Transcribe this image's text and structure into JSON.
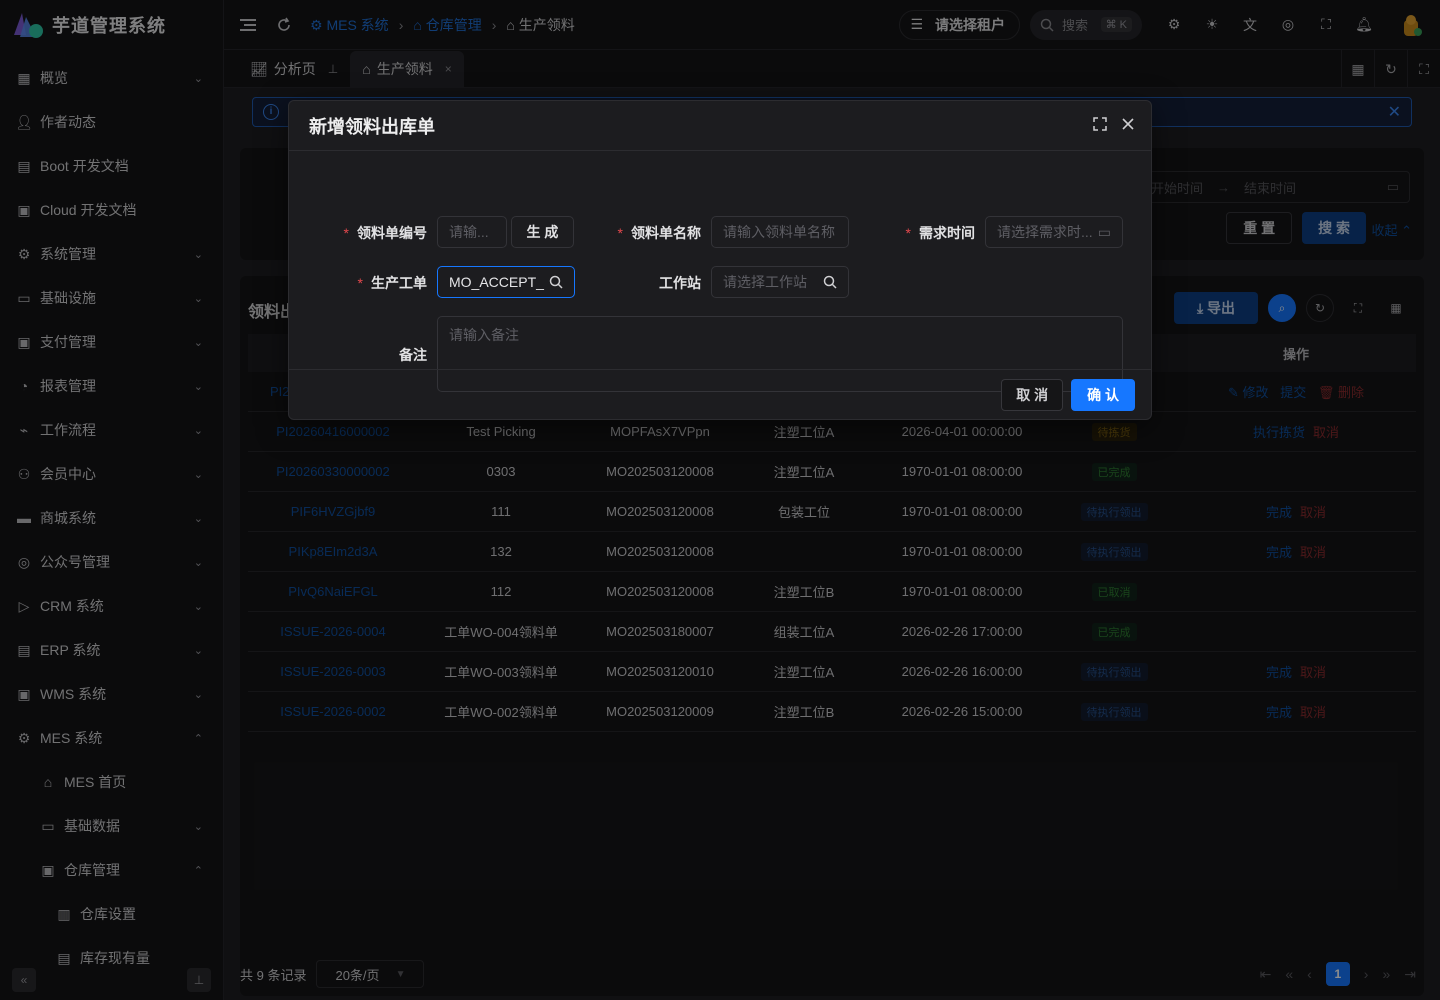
{
  "app": {
    "title": "芋道管理系统"
  },
  "sidebar": {
    "items": [
      {
        "label": "概览",
        "icon": "grid-icon",
        "arrow": "⌄"
      },
      {
        "label": "作者动态",
        "icon": "user-icon",
        "arrow": ""
      },
      {
        "label": "Boot 开发文档",
        "icon": "doc-icon",
        "arrow": ""
      },
      {
        "label": "Cloud 开发文档",
        "icon": "doc2-icon",
        "arrow": ""
      },
      {
        "label": "系统管理",
        "icon": "gear-icon",
        "arrow": "⌄"
      },
      {
        "label": "基础设施",
        "icon": "monitor-icon",
        "arrow": "⌄"
      },
      {
        "label": "支付管理",
        "icon": "pay-icon",
        "arrow": "⌄"
      },
      {
        "label": "报表管理",
        "icon": "pie-icon",
        "arrow": "⌄"
      },
      {
        "label": "工作流程",
        "icon": "flow-icon",
        "arrow": "⌄"
      },
      {
        "label": "会员中心",
        "icon": "members-icon",
        "arrow": "⌄"
      },
      {
        "label": "商城系统",
        "icon": "shop-icon",
        "arrow": "⌄"
      },
      {
        "label": "公众号管理",
        "icon": "compass-icon",
        "arrow": "⌄"
      },
      {
        "label": "CRM 系统",
        "icon": "crm-icon",
        "arrow": "⌄"
      },
      {
        "label": "ERP 系统",
        "icon": "erp-icon",
        "arrow": "⌄"
      },
      {
        "label": "WMS 系统",
        "icon": "box-icon",
        "arrow": "⌄"
      },
      {
        "label": "MES 系统",
        "icon": "chip-icon",
        "arrow": "⌃"
      }
    ],
    "mes_children": [
      {
        "label": "MES 首页",
        "icon": "home-icon",
        "arrow": ""
      },
      {
        "label": "基础数据",
        "icon": "screen-icon",
        "arrow": "⌄"
      },
      {
        "label": "仓库管理",
        "icon": "warehouse-icon",
        "arrow": "⌃"
      }
    ],
    "warehouse_children": [
      {
        "label": "仓库设置",
        "icon": "building-icon"
      },
      {
        "label": "库存现有量",
        "icon": "stock-icon"
      }
    ]
  },
  "header": {
    "breadcrumbs": [
      "MES 系统",
      "仓库管理",
      "生产领料"
    ],
    "tenant": "请选择租户",
    "search_placeholder": "搜索",
    "search_shortcut": "⌘ K"
  },
  "tabs": [
    {
      "label": "分析页",
      "icon": "chart-icon"
    },
    {
      "label": "生产领料",
      "icon": "issue-icon",
      "close": "×"
    }
  ],
  "filter": {
    "start_placeholder": "开始时间",
    "end_placeholder": "结束时间",
    "reset_label": "重 置",
    "search_label": "搜 索",
    "collapse_label": "收起"
  },
  "table": {
    "title": "领料出库单",
    "export_label": "导出",
    "op_header": "操作",
    "rows": [
      {
        "code": "PI20260416000002",
        "name": "Test Picking",
        "order": "MOPFAsX7VPpn",
        "station": "注塑工位A",
        "time": "2026-04-01 00:00:00",
        "status": "待拣货",
        "status_type": "warn",
        "actions": [
          {
            "t": "执行拣货",
            "c": "blue"
          },
          {
            "t": "取消",
            "c": "red"
          }
        ]
      },
      {
        "code": "PI20260330000002",
        "name": "0303",
        "order": "MO202503120008",
        "station": "注塑工位A",
        "time": "1970-01-01 08:00:00",
        "status": "已完成",
        "status_type": "ok",
        "actions": []
      },
      {
        "code": "PIF6HVZGjbf9",
        "name": "111",
        "order": "MO202503120008",
        "station": "包装工位",
        "time": "1970-01-01 08:00:00",
        "status": "待执行领出",
        "status_type": "blue",
        "actions": [
          {
            "t": "完成",
            "c": "blue"
          },
          {
            "t": "取消",
            "c": "red"
          }
        ]
      },
      {
        "code": "PIKp8EIm2d3A",
        "name": "132",
        "order": "MO202503120008",
        "station": "",
        "time": "1970-01-01 08:00:00",
        "status": "待执行领出",
        "status_type": "blue",
        "actions": [
          {
            "t": "完成",
            "c": "blue"
          },
          {
            "t": "取消",
            "c": "red"
          }
        ]
      },
      {
        "code": "PIvQ6NaiEFGL",
        "name": "112",
        "order": "MO202503120008",
        "station": "注塑工位B",
        "time": "1970-01-01 08:00:00",
        "status": "已取消",
        "status_type": "ok",
        "actions": []
      },
      {
        "code": "ISSUE-2026-0004",
        "name": "工单WO-004领料单",
        "order": "MO202503180007",
        "station": "组装工位A",
        "time": "2026-02-26 17:00:00",
        "status": "已完成",
        "status_type": "ok",
        "actions": []
      },
      {
        "code": "ISSUE-2026-0003",
        "name": "工单WO-003领料单",
        "order": "MO202503120010",
        "station": "注塑工位A",
        "time": "2026-02-26 16:00:00",
        "status": "待执行领出",
        "status_type": "blue",
        "actions": [
          {
            "t": "完成",
            "c": "blue"
          },
          {
            "t": "取消",
            "c": "red"
          }
        ]
      },
      {
        "code": "ISSUE-2026-0002",
        "name": "工单WO-002领料单",
        "order": "MO202503120009",
        "station": "注塑工位B",
        "time": "2026-02-26 15:00:00",
        "status": "待执行领出",
        "status_type": "blue",
        "actions": [
          {
            "t": "完成",
            "c": "blue"
          },
          {
            "t": "取消",
            "c": "red"
          }
        ]
      }
    ],
    "first_row_actions": [
      "修改",
      "提交",
      "删除"
    ],
    "first_row_code_fragment": "PI2"
  },
  "pager": {
    "total": "共 9 条记录",
    "page_size": "20条/页",
    "current_page": "1"
  },
  "modal": {
    "title": "新增领料出库单",
    "code_label": "领料单编号",
    "code_placeholder": "请输...",
    "generate_label": "生 成",
    "name_label": "领料单名称",
    "name_placeholder": "请输入领料单名称",
    "time_label": "需求时间",
    "time_placeholder": "请选择需求时...",
    "order_label": "生产工单",
    "order_value": "MO_ACCEPT_I",
    "station_label": "工作站",
    "station_placeholder": "请选择工作站",
    "remark_label": "备注",
    "remark_placeholder": "请输入备注",
    "cancel_label": "取 消",
    "confirm_label": "确 认"
  },
  "colors": {
    "accent": "#1677ff",
    "danger": "#e5484d"
  }
}
